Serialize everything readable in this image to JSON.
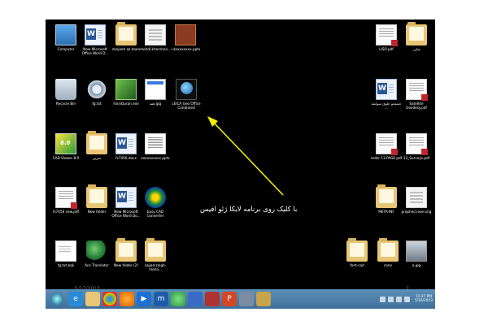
{
  "annotation_text": "با کلیک روی برنامه لایکا ژئو افیس",
  "date_watermark": "5/17/2013",
  "page_number": "2",
  "desktop_icons_left": [
    {
      "label": "Computer",
      "icon": "computer-icon"
    },
    {
      "label": "New Microsoft Office Word D...",
      "icon": "word-document-icon"
    },
    {
      "label": "zanjeeh az doon",
      "icon": "folder-icon"
    },
    {
      "label": "mehdi.khorshna...",
      "icon": "document-icon"
    },
    {
      "label": "~$xxxxxxxx.pptx",
      "icon": "image-file-icon"
    },
    {
      "label": "Recycle Bin",
      "icon": "recycle-bin-icon"
    },
    {
      "label": "fg.txt",
      "icon": "settings-file-icon"
    },
    {
      "label": "FarsiQuran.exe",
      "icon": "exe-icon"
    },
    {
      "label": "فقه.jpg",
      "icon": "webpage-icon"
    },
    {
      "label": "LEICA Geo Office Combined",
      "icon": "leica-geo-office-icon"
    },
    {
      "label": "CAD Viewer 8.0",
      "icon": "cad-viewer-icon"
    },
    {
      "label": "تمرین",
      "icon": "folder-icon"
    },
    {
      "label": "fs7456.docx",
      "icon": "word-document-icon"
    },
    {
      "label": "xxxxxxxxxx.pptx",
      "icon": "presentation-icon"
    },
    {
      "label": "fs7456 new.pdf",
      "icon": "pdf-icon"
    },
    {
      "label": "New folder",
      "icon": "folder-icon"
    },
    {
      "label": "New Microsoft Office Word Do...",
      "icon": "word-document-icon"
    },
    {
      "label": "Easy CAD Converter",
      "icon": "easy-cad-converter-icon"
    },
    {
      "label": "fg.txt.bak",
      "icon": "text-file-icon"
    },
    {
      "label": "Ace Translator",
      "icon": "globe-icon"
    },
    {
      "label": "New folder (2)",
      "icon": "folder-icon"
    },
    {
      "label": "sajjad.zolgh-moha...",
      "icon": "folder-icon"
    }
  ],
  "desktop_icons_right": [
    {
      "label": "LISO.pdf",
      "icon": "pdf-icon"
    },
    {
      "label": "شاپی",
      "icon": "folder-icon"
    },
    {
      "label": "جستجو جلوی سوابقه ...",
      "icon": "word-document-icon"
    },
    {
      "label": "Satellite Geodesy.pdf",
      "icon": "pdf-icon"
    },
    {
      "label": "reder 13-PAGE.pdf",
      "icon": "pdf-icon"
    },
    {
      "label": "12_Surveys.pdf",
      "icon": "pdf-icon"
    },
    {
      "label": "META-INF",
      "icon": "folder-icon"
    },
    {
      "label": "prophect.exe.orig",
      "icon": "document-icon"
    },
    {
      "label": "font-cad",
      "icon": "folder-icon"
    },
    {
      "label": "conv",
      "icon": "folder-icon"
    },
    {
      "label": "a.jpg",
      "icon": "photo-icon"
    }
  ],
  "taskbar": {
    "items": [
      {
        "icon": "internet-explorer-icon",
        "color": "#2a8ad6"
      },
      {
        "icon": "file-explorer-icon",
        "color": "#e8c676"
      },
      {
        "icon": "chrome-icon",
        "color": "#3cba54"
      },
      {
        "icon": "firefox-icon",
        "color": "#e66000"
      },
      {
        "icon": "media-player-icon",
        "color": "#1f6fd1"
      },
      {
        "icon": "mathtype-icon",
        "color": "#1d5ca8"
      },
      {
        "icon": "globe-app-icon",
        "color": "#2f9a4a"
      },
      {
        "icon": "paint-icon",
        "color": "#3a6bc4"
      },
      {
        "icon": "media-app-icon",
        "color": "#b23232"
      },
      {
        "icon": "powerpoint-icon",
        "color": "#d24726"
      },
      {
        "icon": "app-icon",
        "color": "#7a8da0"
      },
      {
        "icon": "app-icon-2",
        "color": "#c7a34a"
      }
    ],
    "clock_time": "11:27 PM",
    "clock_date": "5/16/2013"
  },
  "colors": {
    "desktop": "#000000",
    "annotation": "#ffffff",
    "arrow": "#f4f000",
    "taskbar": "#4a7ba4"
  }
}
